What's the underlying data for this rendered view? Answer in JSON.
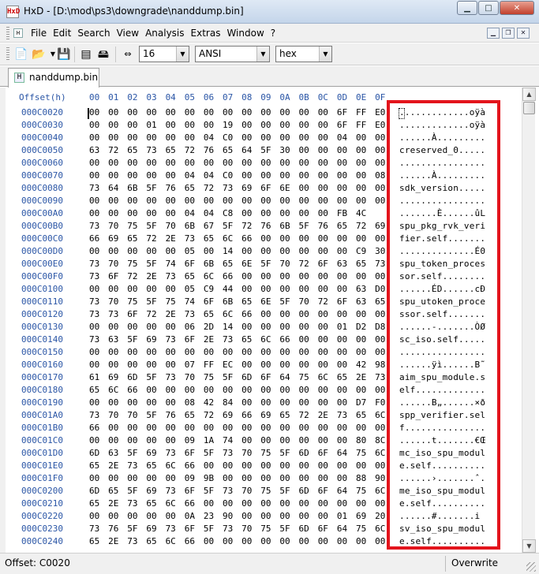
{
  "window": {
    "app_icon_text": "HxD",
    "title": "HxD - [D:\\mod\\ps3\\downgrade\\nanddump.bin]",
    "minimize_glyph": "▁",
    "maximize_glyph": "□",
    "close_glyph": "✕"
  },
  "menu": {
    "items": [
      "File",
      "Edit",
      "Search",
      "View",
      "Analysis",
      "Extras",
      "Window",
      "?"
    ]
  },
  "toolbar": {
    "bytes_per_row": "16",
    "charset": "ANSI",
    "offset_base": "hex",
    "icons": [
      "new-file-icon",
      "open-folder-icon",
      "save-disk-icon",
      "ram-chip-icon",
      "disk-drive-icon",
      "column-width-icon"
    ]
  },
  "tab": {
    "label": "nanddump.bin"
  },
  "editor": {
    "header_offset": "Offset(h)",
    "columns": [
      "00",
      "01",
      "02",
      "03",
      "04",
      "05",
      "06",
      "07",
      "08",
      "09",
      "0A",
      "0B",
      "0C",
      "0D",
      "0E",
      "0F"
    ],
    "rows": [
      {
        "offset": "000C0020",
        "hex": [
          "00",
          "00",
          "00",
          "00",
          "00",
          "00",
          "00",
          "00",
          "00",
          "00",
          "00",
          "00",
          "00",
          "6F",
          "FF",
          "E0"
        ],
        "ascii": ".............oÿà"
      },
      {
        "offset": "000C0030",
        "hex": [
          "00",
          "00",
          "00",
          "01",
          "00",
          "00",
          "00",
          "19",
          "00",
          "00",
          "00",
          "00",
          "00",
          "6F",
          "FF",
          "E0"
        ],
        "ascii": ".............oÿà"
      },
      {
        "offset": "000C0040",
        "hex": [
          "00",
          "00",
          "00",
          "00",
          "00",
          "00",
          "04",
          "C0",
          "00",
          "00",
          "00",
          "00",
          "00",
          "04",
          "00",
          "00"
        ],
        "ascii": "......À........."
      },
      {
        "offset": "000C0050",
        "hex": [
          "63",
          "72",
          "65",
          "73",
          "65",
          "72",
          "76",
          "65",
          "64",
          "5F",
          "30",
          "00",
          "00",
          "00",
          "00",
          "00"
        ],
        "ascii": "creserved_0....."
      },
      {
        "offset": "000C0060",
        "hex": [
          "00",
          "00",
          "00",
          "00",
          "00",
          "00",
          "00",
          "00",
          "00",
          "00",
          "00",
          "00",
          "00",
          "00",
          "00",
          "00"
        ],
        "ascii": "................"
      },
      {
        "offset": "000C0070",
        "hex": [
          "00",
          "00",
          "00",
          "00",
          "00",
          "04",
          "04",
          "C0",
          "00",
          "00",
          "00",
          "00",
          "00",
          "00",
          "00",
          "08"
        ],
        "ascii": "......À........."
      },
      {
        "offset": "000C0080",
        "hex": [
          "73",
          "64",
          "6B",
          "5F",
          "76",
          "65",
          "72",
          "73",
          "69",
          "6F",
          "6E",
          "00",
          "00",
          "00",
          "00",
          "00"
        ],
        "ascii": "sdk_version....."
      },
      {
        "offset": "000C0090",
        "hex": [
          "00",
          "00",
          "00",
          "00",
          "00",
          "00",
          "00",
          "00",
          "00",
          "00",
          "00",
          "00",
          "00",
          "00",
          "00",
          "00"
        ],
        "ascii": "................"
      },
      {
        "offset": "000C00A0",
        "hex": [
          "00",
          "00",
          "00",
          "00",
          "00",
          "04",
          "04",
          "C8",
          "00",
          "00",
          "00",
          "00",
          "00",
          "FB",
          "4C"
        ],
        "ascii": ".......È......ûL"
      },
      {
        "offset": "000C00B0",
        "hex": [
          "73",
          "70",
          "75",
          "5F",
          "70",
          "6B",
          "67",
          "5F",
          "72",
          "76",
          "6B",
          "5F",
          "76",
          "65",
          "72",
          "69"
        ],
        "ascii": "spu_pkg_rvk_veri"
      },
      {
        "offset": "000C00C0",
        "hex": [
          "66",
          "69",
          "65",
          "72",
          "2E",
          "73",
          "65",
          "6C",
          "66",
          "00",
          "00",
          "00",
          "00",
          "00",
          "00",
          "00"
        ],
        "ascii": "fier.self......."
      },
      {
        "offset": "000C00D0",
        "hex": [
          "00",
          "00",
          "00",
          "00",
          "00",
          "05",
          "00",
          "14",
          "00",
          "00",
          "00",
          "00",
          "00",
          "00",
          "C9",
          "30"
        ],
        "ascii": "..............É0"
      },
      {
        "offset": "000C00E0",
        "hex": [
          "73",
          "70",
          "75",
          "5F",
          "74",
          "6F",
          "6B",
          "65",
          "6E",
          "5F",
          "70",
          "72",
          "6F",
          "63",
          "65",
          "73"
        ],
        "ascii": "spu_token_proces"
      },
      {
        "offset": "000C00F0",
        "hex": [
          "73",
          "6F",
          "72",
          "2E",
          "73",
          "65",
          "6C",
          "66",
          "00",
          "00",
          "00",
          "00",
          "00",
          "00",
          "00",
          "00"
        ],
        "ascii": "sor.self........"
      },
      {
        "offset": "000C0100",
        "hex": [
          "00",
          "00",
          "00",
          "00",
          "00",
          "05",
          "C9",
          "44",
          "00",
          "00",
          "00",
          "00",
          "00",
          "00",
          "63",
          "D0"
        ],
        "ascii": "......ÉD......cÐ"
      },
      {
        "offset": "000C0110",
        "hex": [
          "73",
          "70",
          "75",
          "5F",
          "75",
          "74",
          "6F",
          "6B",
          "65",
          "6E",
          "5F",
          "70",
          "72",
          "6F",
          "63",
          "65"
        ],
        "ascii": "spu_utoken_proce"
      },
      {
        "offset": "000C0120",
        "hex": [
          "73",
          "73",
          "6F",
          "72",
          "2E",
          "73",
          "65",
          "6C",
          "66",
          "00",
          "00",
          "00",
          "00",
          "00",
          "00",
          "00"
        ],
        "ascii": "ssor.self......."
      },
      {
        "offset": "000C0130",
        "hex": [
          "00",
          "00",
          "00",
          "00",
          "00",
          "06",
          "2D",
          "14",
          "00",
          "00",
          "00",
          "00",
          "00",
          "01",
          "D2",
          "D8"
        ],
        "ascii": "......-.......ÒØ"
      },
      {
        "offset": "000C0140",
        "hex": [
          "73",
          "63",
          "5F",
          "69",
          "73",
          "6F",
          "2E",
          "73",
          "65",
          "6C",
          "66",
          "00",
          "00",
          "00",
          "00",
          "00"
        ],
        "ascii": "sc_iso.self....."
      },
      {
        "offset": "000C0150",
        "hex": [
          "00",
          "00",
          "00",
          "00",
          "00",
          "00",
          "00",
          "00",
          "00",
          "00",
          "00",
          "00",
          "00",
          "00",
          "00",
          "00"
        ],
        "ascii": "................"
      },
      {
        "offset": "000C0160",
        "hex": [
          "00",
          "00",
          "00",
          "00",
          "00",
          "07",
          "FF",
          "EC",
          "00",
          "00",
          "00",
          "00",
          "00",
          "00",
          "42",
          "98"
        ],
        "ascii": "......ÿì......B˜"
      },
      {
        "offset": "000C0170",
        "hex": [
          "61",
          "69",
          "6D",
          "5F",
          "73",
          "70",
          "75",
          "5F",
          "6D",
          "6F",
          "64",
          "75",
          "6C",
          "65",
          "2E",
          "73"
        ],
        "ascii": "aim_spu_module.s"
      },
      {
        "offset": "000C0180",
        "hex": [
          "65",
          "6C",
          "66",
          "00",
          "00",
          "00",
          "00",
          "00",
          "00",
          "00",
          "00",
          "00",
          "00",
          "00",
          "00",
          "00"
        ],
        "ascii": "elf............."
      },
      {
        "offset": "000C0190",
        "hex": [
          "00",
          "00",
          "00",
          "00",
          "00",
          "08",
          "42",
          "84",
          "00",
          "00",
          "00",
          "00",
          "00",
          "00",
          "D7",
          "F0"
        ],
        "ascii": "......B„......×ð"
      },
      {
        "offset": "000C01A0",
        "hex": [
          "73",
          "70",
          "70",
          "5F",
          "76",
          "65",
          "72",
          "69",
          "66",
          "69",
          "65",
          "72",
          "2E",
          "73",
          "65",
          "6C"
        ],
        "ascii": "spp_verifier.sel"
      },
      {
        "offset": "000C01B0",
        "hex": [
          "66",
          "00",
          "00",
          "00",
          "00",
          "00",
          "00",
          "00",
          "00",
          "00",
          "00",
          "00",
          "00",
          "00",
          "00",
          "00"
        ],
        "ascii": "f..............."
      },
      {
        "offset": "000C01C0",
        "hex": [
          "00",
          "00",
          "00",
          "00",
          "00",
          "09",
          "1A",
          "74",
          "00",
          "00",
          "00",
          "00",
          "00",
          "00",
          "80",
          "8C"
        ],
        "ascii": "......t.......€Œ"
      },
      {
        "offset": "000C01D0",
        "hex": [
          "6D",
          "63",
          "5F",
          "69",
          "73",
          "6F",
          "5F",
          "73",
          "70",
          "75",
          "5F",
          "6D",
          "6F",
          "64",
          "75",
          "6C"
        ],
        "ascii": "mc_iso_spu_modul"
      },
      {
        "offset": "000C01E0",
        "hex": [
          "65",
          "2E",
          "73",
          "65",
          "6C",
          "66",
          "00",
          "00",
          "00",
          "00",
          "00",
          "00",
          "00",
          "00",
          "00",
          "00"
        ],
        "ascii": "e.self.........."
      },
      {
        "offset": "000C01F0",
        "hex": [
          "00",
          "00",
          "00",
          "00",
          "00",
          "09",
          "9B",
          "00",
          "00",
          "00",
          "00",
          "00",
          "00",
          "00",
          "88",
          "90"
        ],
        "ascii": "......›.......ˆ."
      },
      {
        "offset": "000C0200",
        "hex": [
          "6D",
          "65",
          "5F",
          "69",
          "73",
          "6F",
          "5F",
          "73",
          "70",
          "75",
          "5F",
          "6D",
          "6F",
          "64",
          "75",
          "6C"
        ],
        "ascii": "me_iso_spu_modul"
      },
      {
        "offset": "000C0210",
        "hex": [
          "65",
          "2E",
          "73",
          "65",
          "6C",
          "66",
          "00",
          "00",
          "00",
          "00",
          "00",
          "00",
          "00",
          "00",
          "00",
          "00"
        ],
        "ascii": "e.self.........."
      },
      {
        "offset": "000C0220",
        "hex": [
          "00",
          "00",
          "00",
          "00",
          "00",
          "0A",
          "23",
          "90",
          "00",
          "00",
          "00",
          "00",
          "00",
          "01",
          "69",
          "20"
        ],
        "ascii": "......#.......i "
      },
      {
        "offset": "000C0230",
        "hex": [
          "73",
          "76",
          "5F",
          "69",
          "73",
          "6F",
          "5F",
          "73",
          "70",
          "75",
          "5F",
          "6D",
          "6F",
          "64",
          "75",
          "6C"
        ],
        "ascii": "sv_iso_spu_modul"
      },
      {
        "offset": "000C0240",
        "hex": [
          "65",
          "2E",
          "73",
          "65",
          "6C",
          "66",
          "00",
          "00",
          "00",
          "00",
          "00",
          "00",
          "00",
          "00",
          "00",
          "00"
        ],
        "ascii": "e.self.........."
      }
    ]
  },
  "status": {
    "offset": "Offset: C0020",
    "mode": "Overwrite"
  },
  "colors": {
    "offset_blue": "#2b56a6",
    "highlight_red": "#e3141c"
  }
}
